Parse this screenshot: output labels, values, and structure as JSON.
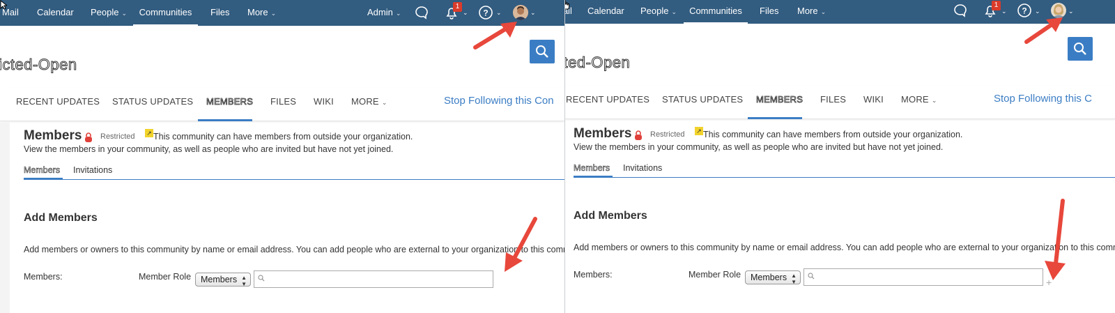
{
  "left": {
    "nav": {
      "mail": "Mail",
      "calendar": "Calendar",
      "people": "People",
      "communities": "Communities",
      "files": "Files",
      "more": "More",
      "admin": "Admin",
      "notifications_count": "1"
    },
    "community_title": "icted-Open",
    "tabs": {
      "recent": "RECENT UPDATES",
      "status": "STATUS UPDATES",
      "members": "MEMBERS",
      "files": "FILES",
      "wiki": "WIKI",
      "more": "MORE",
      "stop_following": "Stop Following this Con"
    },
    "members": {
      "heading": "Members",
      "restricted": "Restricted",
      "external_note": "This community can have members from outside your organization.",
      "description": "View the members in your community, as well as people who are invited but have not yet joined.",
      "subtab_members": "Members",
      "subtab_invitations": "Invitations"
    },
    "add": {
      "heading": "Add Members",
      "description": "Add members or owners to this community by name or email address. You can add people who are external to your organization to this commun",
      "members_label": "Members:",
      "role_label": "Member Role",
      "role_value": "Members",
      "input_value": ""
    }
  },
  "right": {
    "nav": {
      "mail": "Mail",
      "calendar": "Calendar",
      "people": "People",
      "communities": "Communities",
      "files": "Files",
      "more": "More",
      "notifications_count": "1"
    },
    "community_title": "cted-Open",
    "tabs": {
      "recent": "RECENT UPDATES",
      "status": "STATUS UPDATES",
      "members": "MEMBERS",
      "files": "FILES",
      "wiki": "WIKI",
      "more": "MORE",
      "stop_following": "Stop Following this C"
    },
    "members": {
      "heading": "Members",
      "restricted": "Restricted",
      "external_note": "This community can have members from outside your organization.",
      "description": "View the members in your community, as well as people who are invited but have not yet joined.",
      "subtab_members": "Members",
      "subtab_invitations": "Invitations"
    },
    "add": {
      "heading": "Add Members",
      "description": "Add members or owners to this community by name or email address. You can add people who are external to your organization to this commu",
      "members_label": "Members:",
      "role_label": "Member Role",
      "role_value": "Members",
      "input_value": "",
      "add_icon": "+"
    }
  },
  "colors": {
    "nav_bg": "#325c80",
    "accent": "#3b7dc4",
    "badge": "#d93b2b",
    "annotation_arrow": "#e8473b"
  },
  "icons": [
    "chat-bubble-icon",
    "bell-icon",
    "help-icon",
    "search-icon",
    "lock-icon",
    "external-icon",
    "add-icon",
    "annotation-arrow"
  ]
}
